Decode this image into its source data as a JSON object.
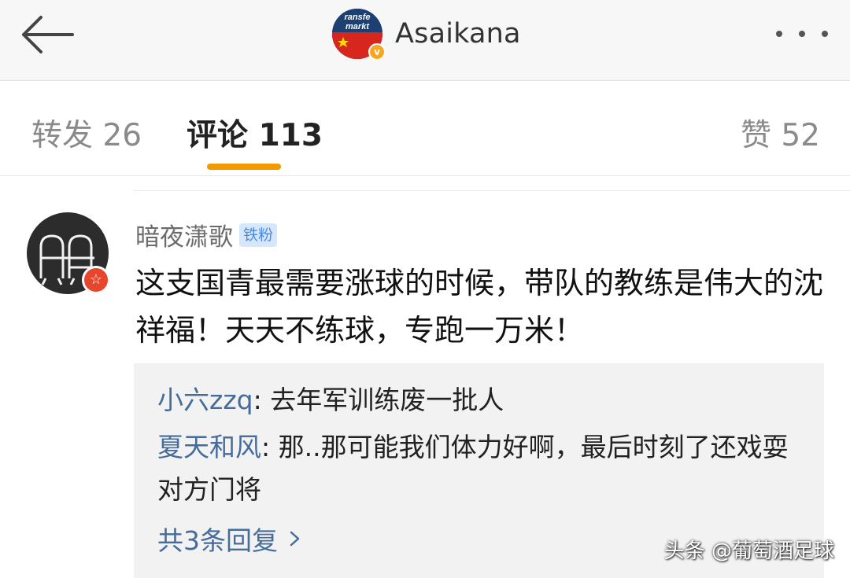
{
  "header": {
    "username": "Asaikana",
    "avatar_text_line1": "ransfe",
    "avatar_text_line2": "markt",
    "verified_mark": "v"
  },
  "tabs": [
    {
      "label": "转发 26"
    },
    {
      "label": "评论 113"
    },
    {
      "label": "赞 52"
    }
  ],
  "comment": {
    "author": "暗夜潇歌",
    "fan_badge": "铁粉",
    "text": "这支国青最需要涨球的时候，带队的教练是伟大的沈祥福！天天不练球，专跑一万米！",
    "avatar_badge_icon": "☆"
  },
  "replies": {
    "items": [
      {
        "name": "小六zzq",
        "text": ": 去年军训练废一批人"
      },
      {
        "name": "夏天和风",
        "text": ": 那..那可能我们体力好啊，最后时刻了还戏耍对方门将"
      }
    ],
    "more_label": "共3条回复"
  },
  "watermark": "头条 @葡萄酒足球",
  "colors": {
    "accent": "#f29a00",
    "link": "#466c9c",
    "badge_bg": "#d7e7fb",
    "badge_text": "#4a8be0"
  }
}
